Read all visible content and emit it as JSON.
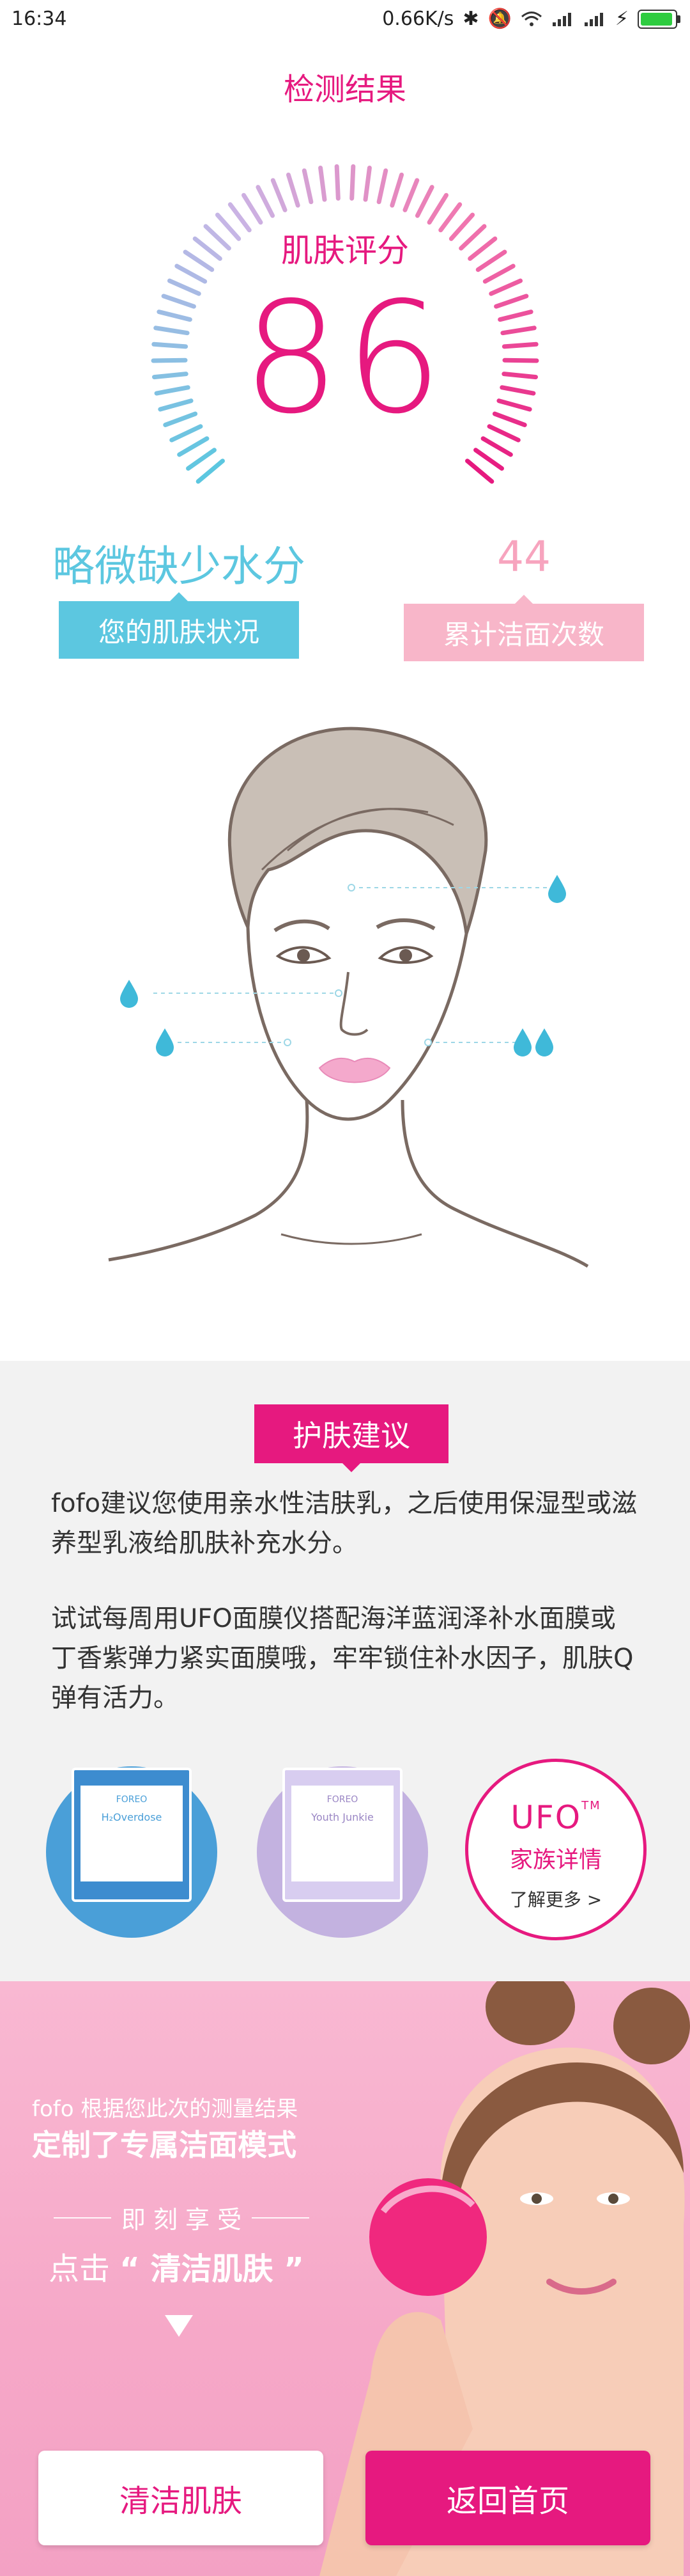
{
  "status_bar": {
    "time": "16:34",
    "network_speed": "0.66K/s"
  },
  "header": {
    "title": "检测结果"
  },
  "gauge": {
    "label": "肌肤评分",
    "score": "86",
    "colors": {
      "cool": "#5cc7e0",
      "warm": "#e6197f"
    }
  },
  "skin_status": {
    "value": "略微缺少水分",
    "label": "您的肌肤状况"
  },
  "wash_count": {
    "value": "44",
    "label": "累计洁面次数"
  },
  "advice": {
    "badge": "护肤建议",
    "paragraph1": "fofo建议您使用亲水性洁肤乳，之后使用保湿型或滋养型乳液给肌肤补充水分。",
    "paragraph2": "试试每周用UFO面膜仪搭配海洋蓝润泽补水面膜或丁香紫弹力紧实面膜哦，牢牢锁住补水因子，肌肤Q弹有活力。"
  },
  "products": {
    "blue_brand": "FOREO",
    "blue_name": "H₂Overdose",
    "purple_brand": "FOREO",
    "purple_name": "Youth Junkie",
    "family_title": "UFO",
    "family_tm": "TM",
    "family_subtitle": "家族详情",
    "family_more": "了解更多 >"
  },
  "promo": {
    "line1": "fofo 根据您此次的测量结果",
    "line2": "定制了专属洁面模式",
    "enjoy": "即 刻 享 受",
    "click_prefix": "点击",
    "click_target": "“ 清洁肌肤 ”"
  },
  "buttons": {
    "clean": "清洁肌肤",
    "home": "返回首页"
  }
}
